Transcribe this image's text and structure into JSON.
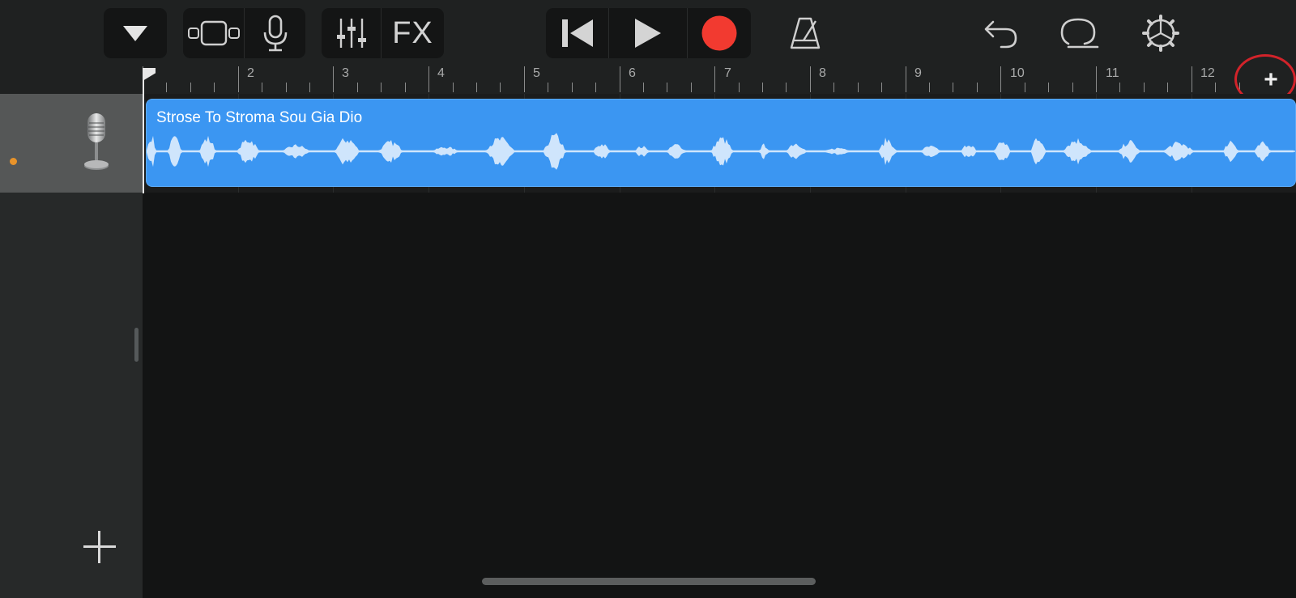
{
  "app": "GarageBand",
  "toolbar": {
    "fx_label": "FX",
    "record_color": "#f23a30",
    "icons": [
      "triangle-down-icon",
      "tracks-view-icon",
      "microphone-icon",
      "mixer-sliders-icon",
      "fx",
      "go-to-beginning-icon",
      "play-icon",
      "record-icon",
      "metronome-icon",
      "undo-icon",
      "loop-icon",
      "settings-gear-icon"
    ]
  },
  "ruler": {
    "bars": [
      "2",
      "3",
      "4",
      "5",
      "6",
      "7",
      "8",
      "9",
      "10",
      "11",
      "12"
    ],
    "add_section_label": "+"
  },
  "track": {
    "instrument_icon": "microphone-icon",
    "active_dot_color": "#e8932a"
  },
  "region": {
    "name": "Strose To Stroma Sou Gia Dio",
    "color": "#3b96f2"
  },
  "annotation": {
    "highlight_color": "#d2232a"
  }
}
